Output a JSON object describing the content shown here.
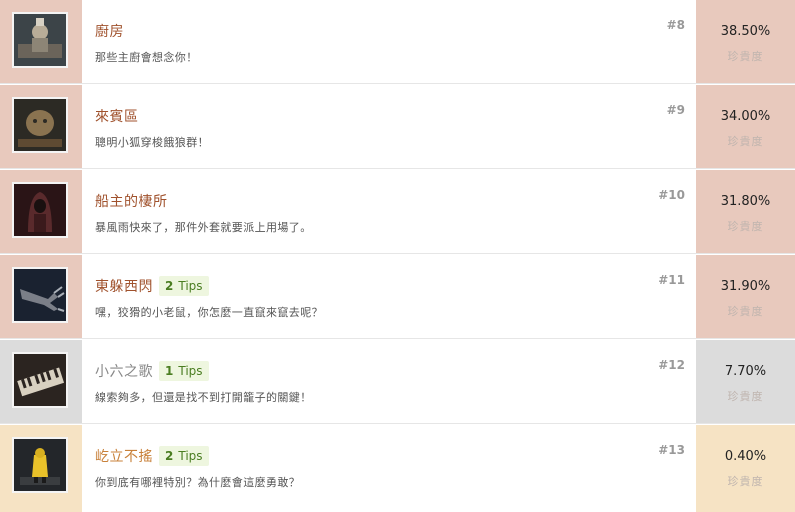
{
  "achievements": [
    {
      "title": "廚房",
      "description": "那些主廚會想念你！",
      "rank": "#8",
      "percent": "38.50%",
      "rarity_label": "珍貴度",
      "tips_count": "",
      "tips_label": "",
      "tier_color": "#e8c9bd",
      "title_color": "#a0522d",
      "icon": "chef-figure-icon"
    },
    {
      "title": "來賓區",
      "description": "聰明小狐穿梭餓狼群！",
      "rank": "#9",
      "percent": "34.00%",
      "rarity_label": "珍貴度",
      "tips_count": "",
      "tips_label": "",
      "tier_color": "#e8c9bd",
      "title_color": "#a0522d",
      "icon": "guest-figure-icon"
    },
    {
      "title": "船主的棲所",
      "description": "暴風雨快來了，那件外套就要派上用場了。",
      "rank": "#10",
      "percent": "31.80%",
      "rarity_label": "珍貴度",
      "tips_count": "",
      "tips_label": "",
      "tier_color": "#e8c9bd",
      "title_color": "#a0522d",
      "icon": "hooded-lady-icon"
    },
    {
      "title": "東躲西閃",
      "description": "嘿，狡猾的小老鼠，你怎麼一直竄來竄去呢？",
      "rank": "#11",
      "percent": "31.90%",
      "rarity_label": "珍貴度",
      "tips_count": "2",
      "tips_label": "Tips",
      "tier_color": "#e8c9bd",
      "title_color": "#a0522d",
      "icon": "grabbing-hand-icon"
    },
    {
      "title": "小六之歌",
      "description": "線索夠多，但還是找不到打開籠子的關鍵！",
      "rank": "#12",
      "percent": "7.70%",
      "rarity_label": "珍貴度",
      "tips_count": "1",
      "tips_label": "Tips",
      "tier_color": "#dcdcdc",
      "title_color": "#888888",
      "icon": "piano-keys-icon"
    },
    {
      "title": "屹立不搖",
      "description": "你到底有哪裡特別？為什麼會這麼勇敢？",
      "rank": "#13",
      "percent": "0.40%",
      "rarity_label": "珍貴度",
      "tips_count": "2",
      "tips_label": "Tips",
      "tier_color": "#f6e3c4",
      "title_color": "#c8813a",
      "icon": "yellow-coat-child-icon"
    }
  ]
}
